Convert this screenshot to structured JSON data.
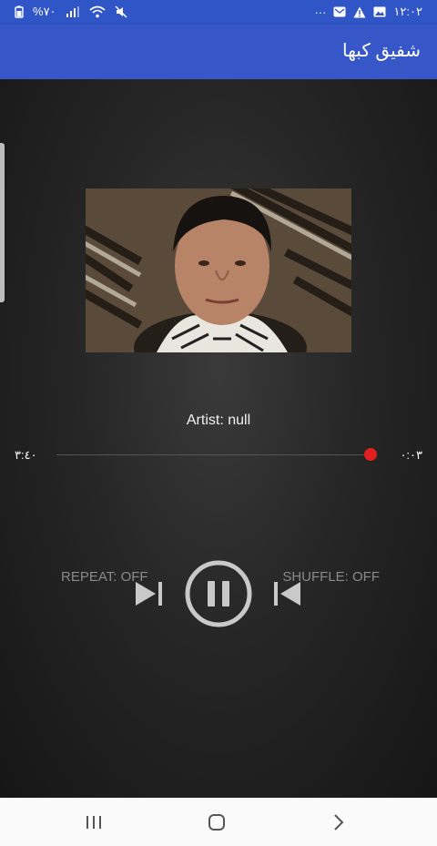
{
  "status_bar": {
    "time": "١٢:٠٢",
    "battery": "%٧٠",
    "more": "···"
  },
  "app_bar": {
    "title": "شفيق كبها"
  },
  "player": {
    "artist_line": "Artist: null",
    "elapsed_time": "٠:٠٣",
    "total_time": "٣:٤٠",
    "progress": 0.014,
    "repeat_label": "REPEAT: OFF",
    "shuffle_label": "SHUFFLE: OFF",
    "state": "playing"
  },
  "colors": {
    "app_bar": "#3757c9",
    "status_bar": "#2f55c6",
    "seek_thumb": "#e01f1f",
    "label_gray": "#8a8a8a"
  },
  "icons": {
    "next": "skip-next-icon",
    "pause": "pause-icon",
    "prev": "skip-previous-icon",
    "nav_recents": "recents-icon",
    "nav_home": "home-icon",
    "nav_back": "back-icon"
  }
}
